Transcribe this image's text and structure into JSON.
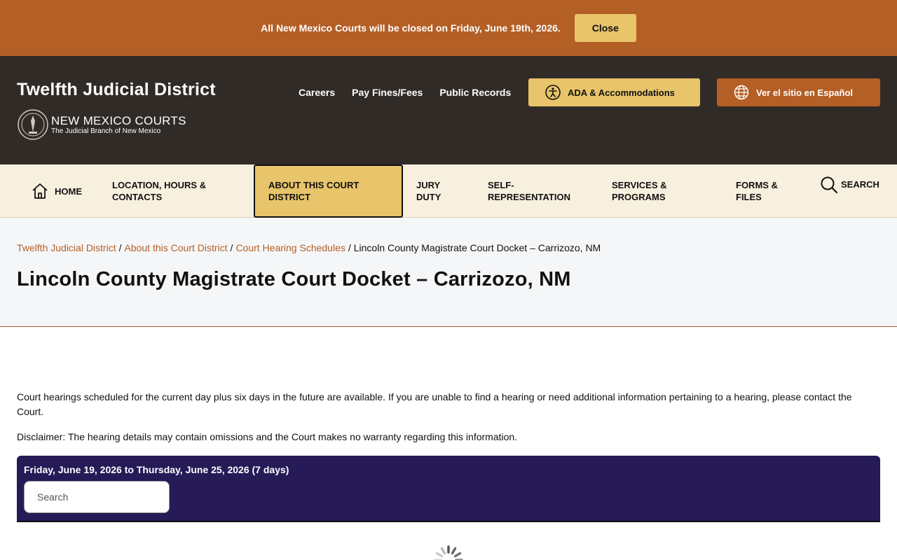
{
  "alert": {
    "message": "All New Mexico Courts will be closed on Friday, June 19th, 2026.",
    "close_label": "Close"
  },
  "header": {
    "site_title": "Twelfth Judicial District",
    "brand_main": "NEW MEXICO COURTS",
    "brand_sub": "The Judicial Branch of New Mexico",
    "util_links": [
      "Careers",
      "Pay Fines/Fees",
      "Public Records"
    ],
    "ada_label": "ADA & Accommodations",
    "lang_label": "Ver el sitio en Español"
  },
  "nav": {
    "home": "HOME",
    "location": "LOCATION, HOURS & CONTACTS",
    "about": "ABOUT THIS COURT DISTRICT",
    "jury": "JURY DUTY",
    "self_rep": "SELF-REPRESENTATION",
    "services": "SERVICES & PROGRAMS",
    "forms": "FORMS & FILES",
    "search": "SEARCH"
  },
  "breadcrumb": {
    "items": [
      "Twelfth Judicial District",
      "About this Court District",
      "Court Hearing Schedules"
    ],
    "current": "Lincoln County Magistrate Court Docket – Carrizozo, NM"
  },
  "page_title": "Lincoln County Magistrate Court Docket – Carrizozo, NM",
  "content": {
    "intro": "Court hearings scheduled for the current day plus six days in the future are available. If you are unable to find a hearing or need additional information pertaining to a hearing, please contact the Court.",
    "disclaimer": "Disclaimer:  The hearing details may contain omissions and the Court makes no warranty regarding this information."
  },
  "docket": {
    "date_range": "Friday, June 19, 2026 to Thursday, June 25, 2026 (7 days)",
    "search_placeholder": "Search"
  },
  "colors": {
    "accent_orange": "#b45f26",
    "accent_gold": "#e8c46a",
    "header_dark": "#312b27",
    "docket_purple": "#261a57"
  }
}
